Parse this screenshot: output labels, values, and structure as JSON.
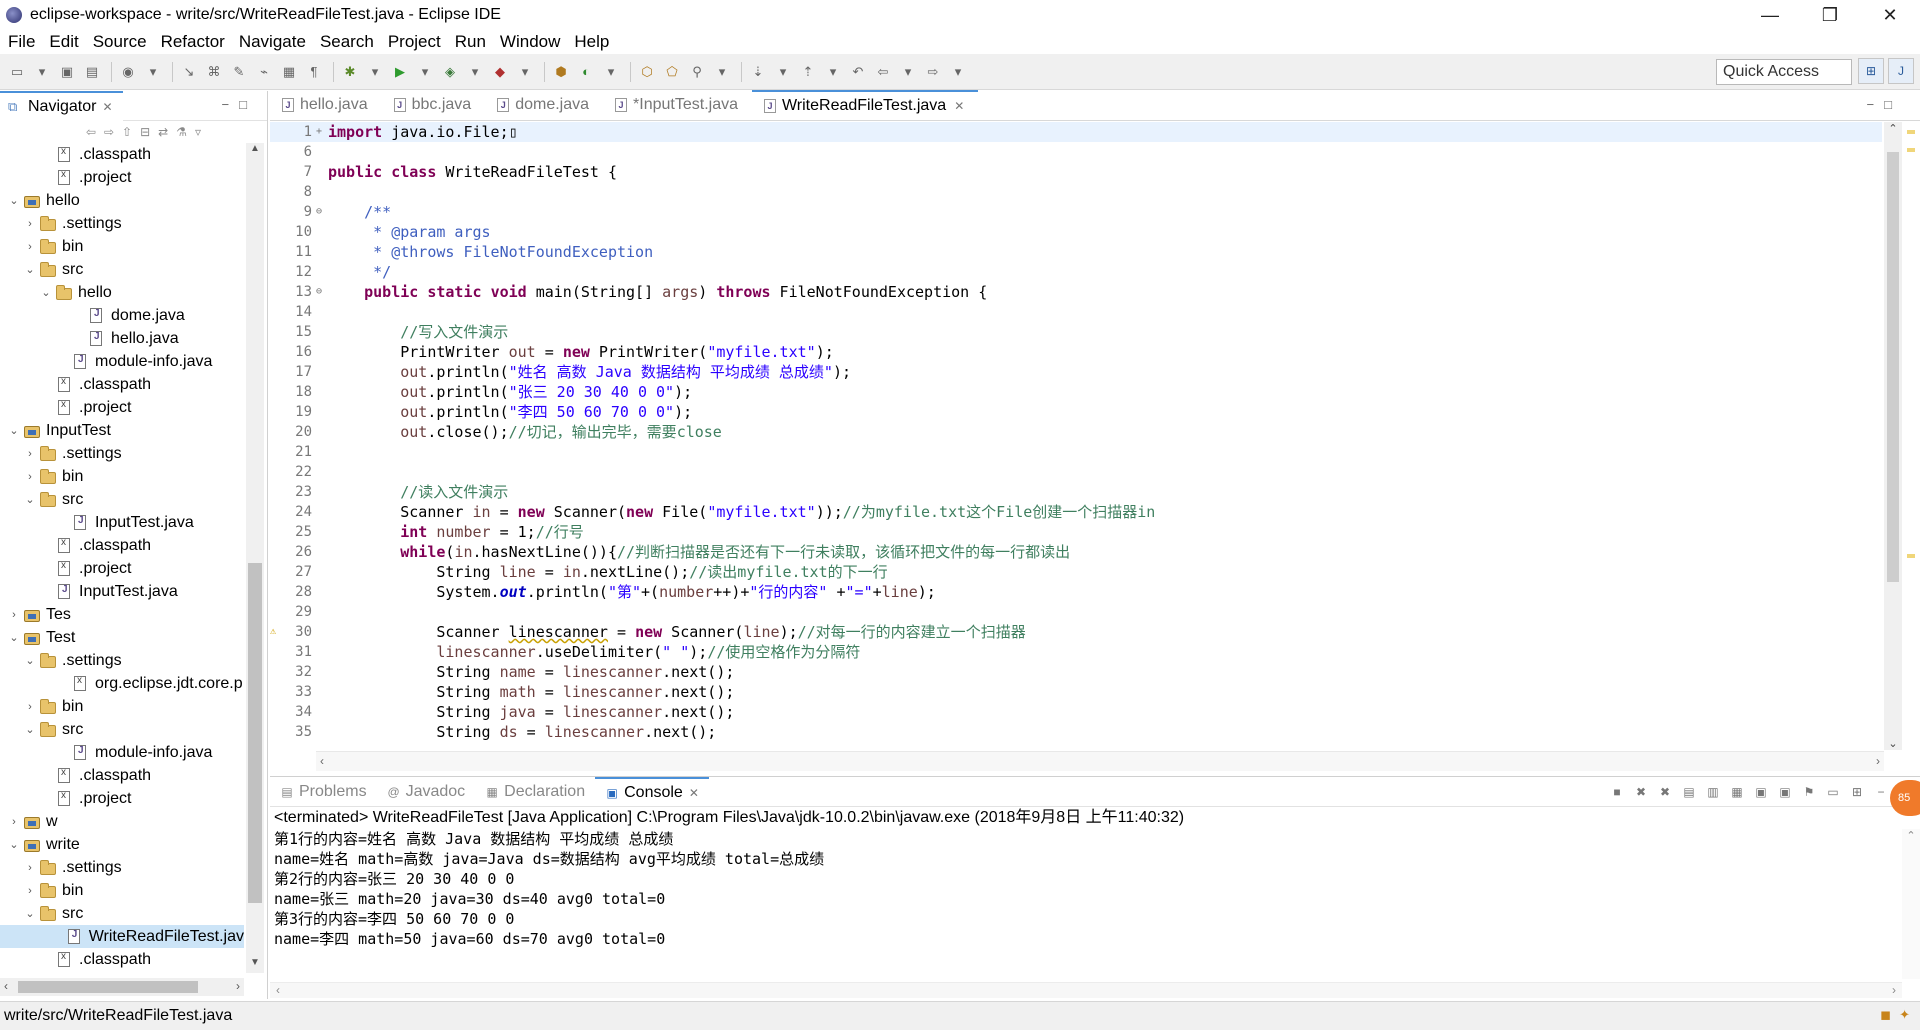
{
  "window": {
    "title": "eclipse-workspace - write/src/WriteReadFileTest.java - Eclipse IDE",
    "minimize": "—",
    "restore": "❐",
    "close": "✕"
  },
  "menu": [
    "File",
    "Edit",
    "Source",
    "Refactor",
    "Navigate",
    "Search",
    "Project",
    "Run",
    "Window",
    "Help"
  ],
  "toolbar": {
    "quick_access_placeholder": "Quick Access"
  },
  "navigator": {
    "tab_label": "Navigator",
    "tree": [
      {
        "label": ".classpath",
        "icon": "file",
        "level": 2,
        "arrow": ""
      },
      {
        "label": ".project",
        "icon": "file",
        "level": 2,
        "arrow": ""
      },
      {
        "label": "hello",
        "icon": "proj",
        "level": 0,
        "arrow": "v"
      },
      {
        "label": ".settings",
        "icon": "folder",
        "level": 1,
        "arrow": ">"
      },
      {
        "label": "bin",
        "icon": "folder",
        "level": 1,
        "arrow": ">"
      },
      {
        "label": "src",
        "icon": "folder",
        "level": 1,
        "arrow": "v"
      },
      {
        "label": "hello",
        "icon": "folder",
        "level": 2,
        "arrow": "v"
      },
      {
        "label": "dome.java",
        "icon": "java",
        "level": 4,
        "arrow": ""
      },
      {
        "label": "hello.java",
        "icon": "java",
        "level": 4,
        "arrow": ""
      },
      {
        "label": "module-info.java",
        "icon": "java",
        "level": 3,
        "arrow": ""
      },
      {
        "label": ".classpath",
        "icon": "file",
        "level": 2,
        "arrow": ""
      },
      {
        "label": ".project",
        "icon": "file",
        "level": 2,
        "arrow": ""
      },
      {
        "label": "InputTest",
        "icon": "proj",
        "level": 0,
        "arrow": "v"
      },
      {
        "label": ".settings",
        "icon": "folder",
        "level": 1,
        "arrow": ">"
      },
      {
        "label": "bin",
        "icon": "folder",
        "level": 1,
        "arrow": ">"
      },
      {
        "label": "src",
        "icon": "folder",
        "level": 1,
        "arrow": "v"
      },
      {
        "label": "InputTest.java",
        "icon": "java",
        "level": 3,
        "arrow": ""
      },
      {
        "label": ".classpath",
        "icon": "file",
        "level": 2,
        "arrow": ""
      },
      {
        "label": ".project",
        "icon": "file",
        "level": 2,
        "arrow": ""
      },
      {
        "label": "InputTest.java",
        "icon": "java",
        "level": 2,
        "arrow": ""
      },
      {
        "label": "Tes",
        "icon": "proj",
        "level": 0,
        "arrow": ">"
      },
      {
        "label": "Test",
        "icon": "proj",
        "level": 0,
        "arrow": "v"
      },
      {
        "label": ".settings",
        "icon": "folder",
        "level": 1,
        "arrow": "v"
      },
      {
        "label": "org.eclipse.jdt.core.p",
        "icon": "file",
        "level": 3,
        "arrow": ""
      },
      {
        "label": "bin",
        "icon": "folder",
        "level": 1,
        "arrow": ">"
      },
      {
        "label": "src",
        "icon": "folder",
        "level": 1,
        "arrow": "v"
      },
      {
        "label": "module-info.java",
        "icon": "java",
        "level": 3,
        "arrow": ""
      },
      {
        "label": ".classpath",
        "icon": "file",
        "level": 2,
        "arrow": ""
      },
      {
        "label": ".project",
        "icon": "file",
        "level": 2,
        "arrow": ""
      },
      {
        "label": "w",
        "icon": "proj",
        "level": 0,
        "arrow": ">"
      },
      {
        "label": "write",
        "icon": "proj",
        "level": 0,
        "arrow": "v"
      },
      {
        "label": ".settings",
        "icon": "folder",
        "level": 1,
        "arrow": ">"
      },
      {
        "label": "bin",
        "icon": "folder",
        "level": 1,
        "arrow": ">"
      },
      {
        "label": "src",
        "icon": "folder",
        "level": 1,
        "arrow": "v"
      },
      {
        "label": "WriteReadFileTest.jav",
        "icon": "java",
        "level": 3,
        "arrow": "",
        "selected": true
      },
      {
        "label": ".classpath",
        "icon": "file",
        "level": 2,
        "arrow": ""
      }
    ]
  },
  "editor": {
    "tabs": [
      {
        "label": "hello.java",
        "active": false
      },
      {
        "label": "bbc.java",
        "active": false
      },
      {
        "label": "dome.java",
        "active": false
      },
      {
        "label": "*InputTest.java",
        "active": false
      },
      {
        "label": "WriteReadFileTest.java",
        "active": true
      }
    ],
    "lines": [
      {
        "n": "1",
        "fold": "+",
        "cur": true,
        "seg": [
          [
            "kw",
            "import"
          ],
          [
            "tx",
            " java.io.File;"
          ],
          [
            "tx",
            "▯"
          ]
        ]
      },
      {
        "n": "6",
        "seg": []
      },
      {
        "n": "7",
        "seg": [
          [
            "kw",
            "public"
          ],
          [
            "tx",
            " "
          ],
          [
            "kw",
            "class"
          ],
          [
            "tx",
            " WriteReadFileTest {"
          ]
        ]
      },
      {
        "n": "8",
        "seg": []
      },
      {
        "n": "9",
        "fold": "⊖",
        "seg": [
          [
            "tx",
            "    "
          ],
          [
            "jd",
            "/**"
          ]
        ]
      },
      {
        "n": "10",
        "seg": [
          [
            "jd",
            "     * @param args"
          ]
        ]
      },
      {
        "n": "11",
        "seg": [
          [
            "jd",
            "     * @throws FileNotFoundException"
          ]
        ]
      },
      {
        "n": "12",
        "seg": [
          [
            "jd",
            "     */"
          ]
        ]
      },
      {
        "n": "13",
        "fold": "⊖",
        "seg": [
          [
            "tx",
            "    "
          ],
          [
            "kw",
            "public"
          ],
          [
            "tx",
            " "
          ],
          [
            "kw",
            "static"
          ],
          [
            "tx",
            " "
          ],
          [
            "kw",
            "void"
          ],
          [
            "tx",
            " main(String[] "
          ],
          [
            "lv",
            "args"
          ],
          [
            "tx",
            ") "
          ],
          [
            "kw",
            "throws"
          ],
          [
            "tx",
            " FileNotFoundException {"
          ]
        ]
      },
      {
        "n": "14",
        "seg": []
      },
      {
        "n": "15",
        "seg": [
          [
            "tx",
            "        "
          ],
          [
            "cm",
            "//写入文件演示"
          ]
        ]
      },
      {
        "n": "16",
        "seg": [
          [
            "tx",
            "        PrintWriter "
          ],
          [
            "lv",
            "out"
          ],
          [
            "tx",
            " = "
          ],
          [
            "kw",
            "new"
          ],
          [
            "tx",
            " PrintWriter("
          ],
          [
            "st",
            "\"myfile.txt\""
          ],
          [
            "tx",
            ");"
          ]
        ]
      },
      {
        "n": "17",
        "seg": [
          [
            "tx",
            "        "
          ],
          [
            "lv",
            "out"
          ],
          [
            "tx",
            ".println("
          ],
          [
            "st",
            "\"姓名 高数 Java 数据结构 平均成绩 总成绩\""
          ],
          [
            "tx",
            ");"
          ]
        ]
      },
      {
        "n": "18",
        "seg": [
          [
            "tx",
            "        "
          ],
          [
            "lv",
            "out"
          ],
          [
            "tx",
            ".println("
          ],
          [
            "st",
            "\"张三 20 30 40 0 0\""
          ],
          [
            "tx",
            ");"
          ]
        ]
      },
      {
        "n": "19",
        "seg": [
          [
            "tx",
            "        "
          ],
          [
            "lv",
            "out"
          ],
          [
            "tx",
            ".println("
          ],
          [
            "st",
            "\"李四 50 60 70 0 0\""
          ],
          [
            "tx",
            ");"
          ]
        ]
      },
      {
        "n": "20",
        "seg": [
          [
            "tx",
            "        "
          ],
          [
            "lv",
            "out"
          ],
          [
            "tx",
            ".close();"
          ],
          [
            "cm",
            "//切记，输出完毕，需要close"
          ]
        ]
      },
      {
        "n": "21",
        "seg": []
      },
      {
        "n": "22",
        "seg": []
      },
      {
        "n": "23",
        "seg": [
          [
            "tx",
            "        "
          ],
          [
            "cm",
            "//读入文件演示"
          ]
        ]
      },
      {
        "n": "24",
        "seg": [
          [
            "tx",
            "        Scanner "
          ],
          [
            "lv",
            "in"
          ],
          [
            "tx",
            " = "
          ],
          [
            "kw",
            "new"
          ],
          [
            "tx",
            " Scanner("
          ],
          [
            "kw",
            "new"
          ],
          [
            "tx",
            " File("
          ],
          [
            "st",
            "\"myfile.txt\""
          ],
          [
            "tx",
            "));"
          ],
          [
            "cm",
            "//为myfile.txt这个File创建一个扫描器in"
          ]
        ]
      },
      {
        "n": "25",
        "seg": [
          [
            "tx",
            "        "
          ],
          [
            "kw",
            "int"
          ],
          [
            "tx",
            " "
          ],
          [
            "lv",
            "number"
          ],
          [
            "tx",
            " = 1;"
          ],
          [
            "cm",
            "//行号"
          ]
        ]
      },
      {
        "n": "26",
        "seg": [
          [
            "tx",
            "        "
          ],
          [
            "kw",
            "while"
          ],
          [
            "tx",
            "("
          ],
          [
            "lv",
            "in"
          ],
          [
            "tx",
            ".hasNextLine()){"
          ],
          [
            "cm",
            "//判断扫描器是否还有下一行未读取，该循环把文件的每一行都读出"
          ]
        ]
      },
      {
        "n": "27",
        "seg": [
          [
            "tx",
            "            String "
          ],
          [
            "lv",
            "line"
          ],
          [
            "tx",
            " = "
          ],
          [
            "lv",
            "in"
          ],
          [
            "tx",
            ".nextLine();"
          ],
          [
            "cm",
            "//读出myfile.txt的下一行"
          ]
        ]
      },
      {
        "n": "28",
        "seg": [
          [
            "tx",
            "            System."
          ],
          [
            "sf",
            "out"
          ],
          [
            "tx",
            ".println("
          ],
          [
            "st",
            "\"第\""
          ],
          [
            "tx",
            "+("
          ],
          [
            "lv",
            "number"
          ],
          [
            "tx",
            "++)+"
          ],
          [
            "st",
            "\"行的内容\""
          ],
          [
            "tx",
            " +"
          ],
          [
            "st",
            "\"=\""
          ],
          [
            "tx",
            "+"
          ],
          [
            "lv",
            "line"
          ],
          [
            "tx",
            ");"
          ]
        ]
      },
      {
        "n": "29",
        "seg": []
      },
      {
        "n": "30",
        "warn": true,
        "seg": [
          [
            "tx",
            "            Scanner "
          ],
          [
            "warn",
            "linescanner"
          ],
          [
            "tx",
            " = "
          ],
          [
            "kw",
            "new"
          ],
          [
            "tx",
            " Scanner("
          ],
          [
            "lv",
            "line"
          ],
          [
            "tx",
            ");"
          ],
          [
            "cm",
            "//对每一行的内容建立一个扫描器"
          ]
        ]
      },
      {
        "n": "31",
        "seg": [
          [
            "tx",
            "            "
          ],
          [
            "lv",
            "linescanner"
          ],
          [
            "tx",
            ".useDelimiter("
          ],
          [
            "st",
            "\" \""
          ],
          [
            "tx",
            ");"
          ],
          [
            "cm",
            "//使用空格作为分隔符"
          ]
        ]
      },
      {
        "n": "32",
        "seg": [
          [
            "tx",
            "            String "
          ],
          [
            "lv",
            "name"
          ],
          [
            "tx",
            " = "
          ],
          [
            "lv",
            "linescanner"
          ],
          [
            "tx",
            ".next();"
          ]
        ]
      },
      {
        "n": "33",
        "seg": [
          [
            "tx",
            "            String "
          ],
          [
            "lv",
            "math"
          ],
          [
            "tx",
            " = "
          ],
          [
            "lv",
            "linescanner"
          ],
          [
            "tx",
            ".next();"
          ]
        ]
      },
      {
        "n": "34",
        "seg": [
          [
            "tx",
            "            String "
          ],
          [
            "lv",
            "java"
          ],
          [
            "tx",
            " = "
          ],
          [
            "lv",
            "linescanner"
          ],
          [
            "tx",
            ".next();"
          ]
        ]
      },
      {
        "n": "35",
        "seg": [
          [
            "tx",
            "            String "
          ],
          [
            "lv",
            "ds"
          ],
          [
            "tx",
            " = "
          ],
          [
            "lv",
            "linescanner"
          ],
          [
            "tx",
            ".next();"
          ]
        ]
      }
    ]
  },
  "console": {
    "tabs": [
      {
        "label": "Problems",
        "icon": "▤",
        "active": false
      },
      {
        "label": "Javadoc",
        "icon": "@",
        "active": false
      },
      {
        "label": "Declaration",
        "icon": "▦",
        "active": false
      },
      {
        "label": "Console",
        "icon": "▣",
        "active": true
      }
    ],
    "status": "<terminated> WriteReadFileTest [Java Application] C:\\Program Files\\Java\\jdk-10.0.2\\bin\\javaw.exe (2018年9月8日 上午11:40:32)",
    "output": [
      "第1行的内容=姓名 高数 Java 数据结构 平均成绩 总成绩",
      "name=姓名 math=高数 java=Java ds=数据结构 avg平均成绩 total=总成绩",
      "第2行的内容=张三 20 30 40 0 0",
      "name=张三 math=20 java=30 ds=40 avg0 total=0",
      "第3行的内容=李四 50 60 70 0 0",
      "name=李四 math=50 java=60 ds=70 avg0 total=0"
    ],
    "badge": "85"
  },
  "statusbar": {
    "path": "write/src/WriteReadFileTest.java"
  }
}
